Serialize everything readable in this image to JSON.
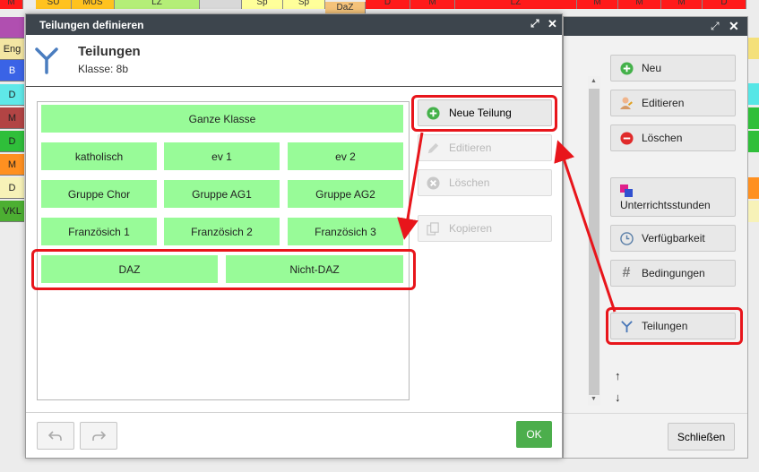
{
  "colors": {
    "accent_red": "#e8151b",
    "group_green": "#98fb98",
    "title_bar": "#3d454d",
    "ok_green": "#4cae4c"
  },
  "background": {
    "top_row": [
      "M",
      "SU",
      "MUS",
      "LZ",
      "Sp",
      "Sp",
      "DaZ",
      "D",
      "M",
      "LZ",
      "M",
      "M",
      "M",
      "D"
    ],
    "left_col": [
      "Eng",
      "B",
      "D",
      "M",
      "D",
      "M",
      "D",
      "VKL"
    ]
  },
  "back_window": {
    "title_controls": [
      "expand-icon",
      "close-icon"
    ],
    "buttons": {
      "neu": "Neu",
      "editieren": "Editieren",
      "loeschen": "Löschen",
      "unterrichtsstunden": "Unterrichtsstunden",
      "verfuegbarkeit": "Verfügbarkeit",
      "bedingungen": "Bedingungen",
      "teilungen": "Teilungen"
    },
    "close_label": "Schließen"
  },
  "dialog": {
    "title": "Teilungen definieren",
    "heading": "Teilungen",
    "subheading": "Klasse: 8b",
    "groups": {
      "whole": "Ganze Klasse",
      "row1": [
        "katholisch",
        "ev 1",
        "ev 2"
      ],
      "row2": [
        "Gruppe Chor",
        "Gruppe AG1",
        "Gruppe AG2"
      ],
      "row3": [
        "Französich 1",
        "Französich 2",
        "Französich 3"
      ],
      "row4": [
        "DAZ",
        "Nicht-DAZ"
      ]
    },
    "buttons": {
      "neue_teilung": "Neue Teilung",
      "editieren": "Editieren",
      "loeschen": "Löschen",
      "kopieren": "Kopieren",
      "ok": "OK"
    }
  }
}
